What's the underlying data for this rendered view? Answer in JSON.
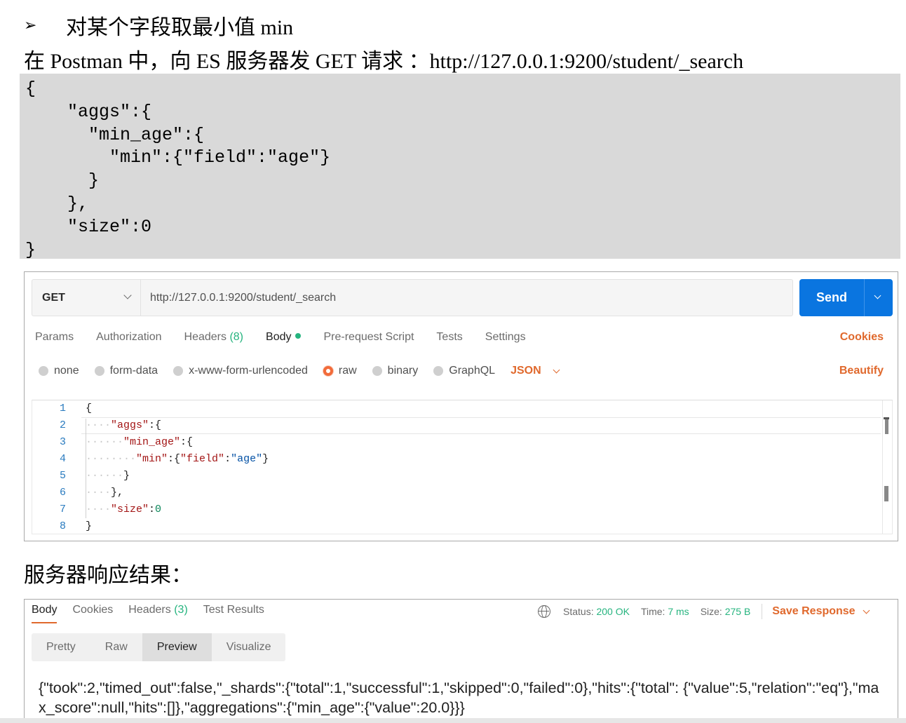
{
  "document": {
    "heading_bullet": "➢",
    "heading_text": "对某个字段取最小值 min",
    "intro_text": "在  Postman 中，向 ES 服务器发 GET 请求 ：http://127.0.0.1:9200/student/_search",
    "code_block": "{\n    \"aggs\":{\n      \"min_age\":{\n        \"min\":{\"field\":\"age\"}\n      }\n    },\n    \"size\":0\n}",
    "result_caption": "服务器响应结果："
  },
  "request": {
    "method": "GET",
    "url": "http://127.0.0.1:9200/student/_search",
    "send_label": "Send",
    "tabs": {
      "params": "Params",
      "authorization": "Authorization",
      "headers": "Headers",
      "headers_count": "(8)",
      "body": "Body",
      "prerequest": "Pre-request Script",
      "tests": "Tests",
      "settings": "Settings"
    },
    "cookies_label": "Cookies",
    "body_types": {
      "none": "none",
      "form_data": "form-data",
      "urlencoded": "x-www-form-urlencoded",
      "raw": "raw",
      "binary": "binary",
      "graphql": "GraphQL"
    },
    "format": "JSON",
    "beautify_label": "Beautify",
    "editor_line_numbers": [
      "1",
      "2",
      "3",
      "4",
      "5",
      "6",
      "7",
      "8"
    ]
  },
  "response": {
    "tabs": {
      "body": "Body",
      "cookies": "Cookies",
      "headers": "Headers",
      "headers_count": "(3)",
      "test_results": "Test Results"
    },
    "status_label": "Status:",
    "status_value": "200 OK",
    "time_label": "Time:",
    "time_value": "7 ms",
    "size_label": "Size:",
    "size_value": "275 B",
    "save_label": "Save Response",
    "view_modes": {
      "pretty": "Pretty",
      "raw": "Raw",
      "preview": "Preview",
      "visualize": "Visualize"
    },
    "body_text": "{\"took\":2,\"timed_out\":false,\"_shards\":{\"total\":1,\"successful\":1,\"skipped\":0,\"failed\":0},\"hits\":{\"total\": {\"value\":5,\"relation\":\"eq\"},\"max_score\":null,\"hits\":[]},\"aggregations\":{\"min_age\":{\"value\":20.0}}}"
  },
  "colors": {
    "accent_orange": "#e0692d",
    "send_blue": "#0a75e0",
    "success_green": "#26b47f",
    "code_block_bg": "#d9d9d9"
  }
}
